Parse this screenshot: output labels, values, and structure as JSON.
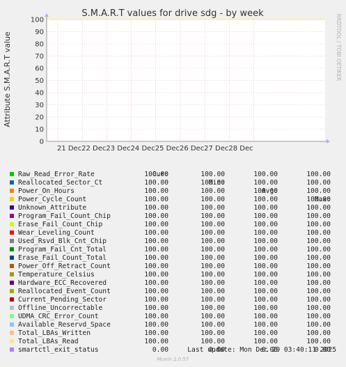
{
  "chart_data": {
    "type": "line",
    "title": "S.M.A.R.T values for drive sdg - by week",
    "ylabel": "Attribute S.M.A.R.T value",
    "ylim": [
      0,
      100
    ],
    "yticks": [
      0,
      10,
      20,
      30,
      40,
      50,
      60,
      70,
      80,
      90,
      100
    ],
    "x_tick_labels": [
      "21 Dec",
      "22 Dec",
      "23 Dec",
      "24 Dec",
      "25 Dec",
      "26 Dec",
      "27 Dec",
      "28 Dec"
    ],
    "grid": true,
    "series": [
      {
        "name": "Raw_Read_Error_Rate",
        "color": "#00cc00",
        "cur": "100.00",
        "min": "100.00",
        "avg": "100.00",
        "max": "100.00",
        "value": 100
      },
      {
        "name": "Reallocated_Sector_Ct",
        "color": "#0066b3",
        "cur": "100.00",
        "min": "100.00",
        "avg": "100.00",
        "max": "100.00",
        "value": 100
      },
      {
        "name": "Power_On_Hours",
        "color": "#ff8000",
        "cur": "100.00",
        "min": "100.00",
        "avg": "100.00",
        "max": "100.00",
        "value": 100
      },
      {
        "name": "Power_Cycle_Count",
        "color": "#ffcc00",
        "cur": "100.00",
        "min": "100.00",
        "avg": "100.00",
        "max": "100.00",
        "value": 100
      },
      {
        "name": "Unknown_Attribute",
        "color": "#330099",
        "cur": "100.00",
        "min": "100.00",
        "avg": "100.00",
        "max": "100.00",
        "value": 100
      },
      {
        "name": "Program_Fail_Count_Chip",
        "color": "#990099",
        "cur": "100.00",
        "min": "100.00",
        "avg": "100.00",
        "max": "100.00",
        "value": 100
      },
      {
        "name": "Erase_Fail_Count_Chip",
        "color": "#ccff00",
        "cur": "100.00",
        "min": "100.00",
        "avg": "100.00",
        "max": "100.00",
        "value": 100
      },
      {
        "name": "Wear_Leveling_Count",
        "color": "#ff0000",
        "cur": "100.00",
        "min": "100.00",
        "avg": "100.00",
        "max": "100.00",
        "value": 100
      },
      {
        "name": "Used_Rsvd_Blk_Cnt_Chip",
        "color": "#808080",
        "cur": "100.00",
        "min": "100.00",
        "avg": "100.00",
        "max": "100.00",
        "value": 100
      },
      {
        "name": "Program_Fail_Cnt_Total",
        "color": "#008f00",
        "cur": "100.00",
        "min": "100.00",
        "avg": "100.00",
        "max": "100.00",
        "value": 100
      },
      {
        "name": "Erase_Fail_Count_Total",
        "color": "#00487d",
        "cur": "100.00",
        "min": "100.00",
        "avg": "100.00",
        "max": "100.00",
        "value": 100
      },
      {
        "name": "Power_Off_Retract_Count",
        "color": "#b35a00",
        "cur": "100.00",
        "min": "100.00",
        "avg": "100.00",
        "max": "100.00",
        "value": 100
      },
      {
        "name": "Temperature_Celsius",
        "color": "#b38f00",
        "cur": "100.00",
        "min": "100.00",
        "avg": "100.00",
        "max": "100.00",
        "value": 100
      },
      {
        "name": "Hardware_ECC_Recovered",
        "color": "#6b006b",
        "cur": "100.00",
        "min": "100.00",
        "avg": "100.00",
        "max": "100.00",
        "value": 100
      },
      {
        "name": "Reallocated_Event_Count",
        "color": "#8fb300",
        "cur": "100.00",
        "min": "100.00",
        "avg": "100.00",
        "max": "100.00",
        "value": 100
      },
      {
        "name": "Current_Pending_Sector",
        "color": "#b30000",
        "cur": "100.00",
        "min": "100.00",
        "avg": "100.00",
        "max": "100.00",
        "value": 100
      },
      {
        "name": "Offline_Uncorrectable",
        "color": "#bebebe",
        "cur": "100.00",
        "min": "100.00",
        "avg": "100.00",
        "max": "100.00",
        "value": 100
      },
      {
        "name": "UDMA_CRC_Error_Count",
        "color": "#80ff80",
        "cur": "100.00",
        "min": "100.00",
        "avg": "100.00",
        "max": "100.00",
        "value": 100
      },
      {
        "name": "Available_Reservd_Space",
        "color": "#80c9ff",
        "cur": "100.00",
        "min": "100.00",
        "avg": "100.00",
        "max": "100.00",
        "value": 100
      },
      {
        "name": "Total_LBAs_Written",
        "color": "#ffc080",
        "cur": "100.00",
        "min": "100.00",
        "avg": "100.00",
        "max": "100.00",
        "value": 100
      },
      {
        "name": "Total_LBAs_Read",
        "color": "#ffe680",
        "cur": "100.00",
        "min": "100.00",
        "avg": "100.00",
        "max": "100.00",
        "value": 100
      },
      {
        "name": "smartctl_exit_status",
        "color": "#aa80ff",
        "cur": "0.00",
        "min": "0.00",
        "avg": "0.00",
        "max": "0.00",
        "value": 0
      }
    ]
  },
  "legend": {
    "cur_label": "Cur:",
    "min_label": "Min:",
    "avg_label": "Avg:",
    "max_label": "Max:"
  },
  "last_update": "Last update: Mon Dec 29 03:40:11 2025",
  "footer": "Munin 2.0.57",
  "side_text": "RRDTOOL / TOBI OETIKER",
  "colors": {
    "background": "#f0f0f0",
    "plot_bg": "#ffffff",
    "grid": "#e8a0a0",
    "axis": "#999999"
  }
}
